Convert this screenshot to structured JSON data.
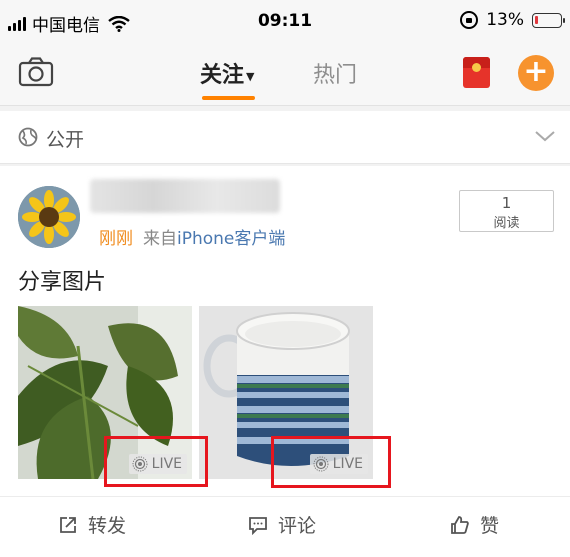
{
  "status_bar": {
    "carrier": "中国电信",
    "time": "09:11",
    "battery_percent": "13%",
    "battery_level": 0.13,
    "battery_color": "#e0383e"
  },
  "nav": {
    "tab_follow": "关注",
    "tab_hot": "热门",
    "camera_icon": "camera-icon",
    "add_icon": "plus-icon",
    "accent_color": "#ff8200"
  },
  "visibility": {
    "label": "公开",
    "icon": "globe-icon"
  },
  "post": {
    "time": "刚刚",
    "source_prefix": "来自",
    "source": "iPhone客户端",
    "read_count": "1",
    "read_label": "阅读",
    "text": "分享图片",
    "images": [
      {
        "badge": "LIVE"
      },
      {
        "badge": "LIVE"
      }
    ]
  },
  "actions": {
    "repost": "转发",
    "comment": "评论",
    "like": "赞"
  }
}
